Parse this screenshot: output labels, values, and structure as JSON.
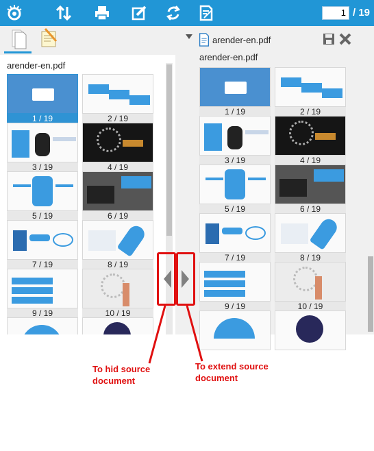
{
  "toolbar": {
    "current_page": "1",
    "page_total": "/ 19",
    "icons": [
      "logo-eye-icon",
      "swap-arrows-icon",
      "printer-icon",
      "edit-icon",
      "rotate-icon",
      "document-edit-icon"
    ]
  },
  "left": {
    "doc_title": "arender-en.pdf",
    "thumbs": [
      {
        "label": "1 / 19",
        "selected": true
      },
      {
        "label": "2 / 19"
      },
      {
        "label": "3 / 19"
      },
      {
        "label": "4 / 19"
      },
      {
        "label": "5 / 19"
      },
      {
        "label": "6 / 19"
      },
      {
        "label": "7 / 19"
      },
      {
        "label": "8 / 19"
      },
      {
        "label": "9 / 19"
      },
      {
        "label": "10 / 19"
      }
    ]
  },
  "right": {
    "doc_title": "arender-en.pdf",
    "doc_subtitle": "arender-en.pdf",
    "thumbs": [
      {
        "label": "1 / 19"
      },
      {
        "label": "2 / 19"
      },
      {
        "label": "3 / 19"
      },
      {
        "label": "4 / 19"
      },
      {
        "label": "5 / 19"
      },
      {
        "label": "6 / 19"
      },
      {
        "label": "7 / 19"
      },
      {
        "label": "8 / 19"
      },
      {
        "label": "9 / 19"
      },
      {
        "label": "10 / 19"
      }
    ]
  },
  "annotations": {
    "hide": "To hid source document",
    "extend": "To extend source document"
  },
  "colors": {
    "toolbar": "#2196d6",
    "selected": "#2f93d4",
    "annotation": "#e01010"
  }
}
